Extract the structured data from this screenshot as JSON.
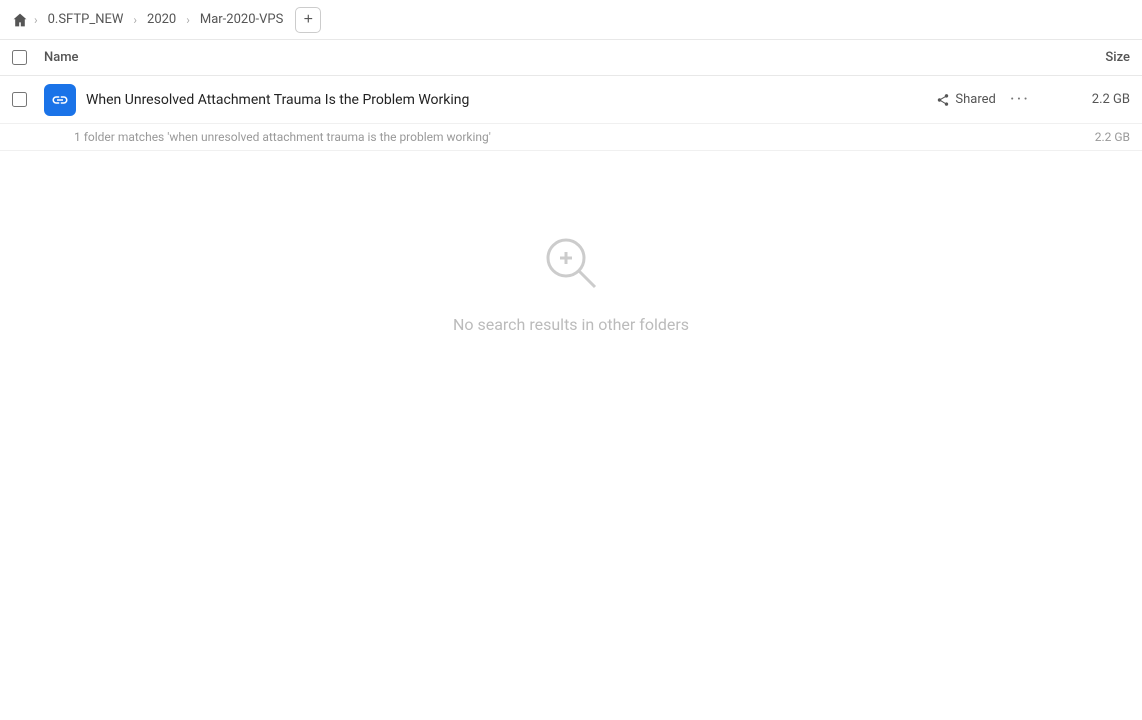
{
  "breadcrumb": {
    "home_icon": "home",
    "items": [
      {
        "label": "0.SFTP_NEW",
        "id": "sftp-new"
      },
      {
        "label": "2020",
        "id": "2020"
      },
      {
        "label": "Mar-2020-VPS",
        "id": "mar-2020-vps"
      }
    ],
    "add_button_label": "+"
  },
  "columns": {
    "name_label": "Name",
    "size_label": "Size"
  },
  "file_row": {
    "icon_type": "link",
    "name": "When Unresolved Attachment Trauma Is the Problem Working",
    "shared_label": "Shared",
    "more_icon": "···",
    "size": "2.2 GB"
  },
  "summary": {
    "text": "1 folder matches 'when unresolved attachment trauma is the problem working'",
    "size": "2.2 GB"
  },
  "empty_state": {
    "icon": "search",
    "message": "No search results in other folders"
  }
}
